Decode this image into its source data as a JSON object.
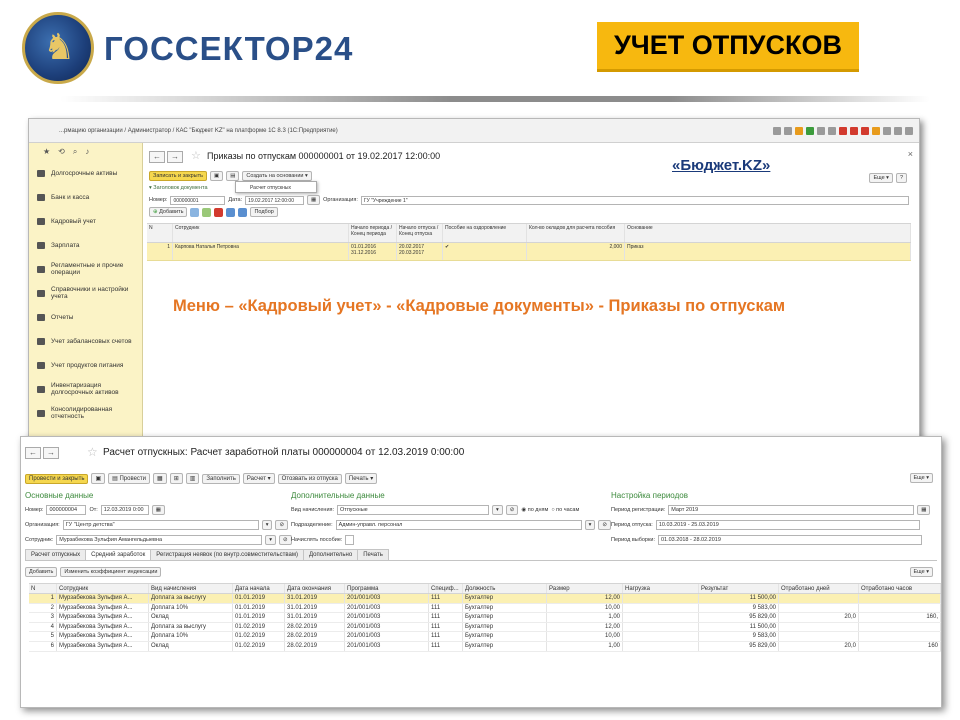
{
  "slide": {
    "logo_text": "ГОССЕКТОР24",
    "title_badge": "УЧЕТ ОТПУСКОВ",
    "caption": "Меню – «Кадровый учет» - «Кадровые документы» - Приказы по отпускам",
    "budget_link": "«Бюджет.KZ»",
    "colors": {
      "badge": "#f7b80f",
      "caption": "#e57623",
      "brand_blue": "#2a4f88"
    }
  },
  "window1": {
    "titlebar": "...рмацию организации / Администратор / КАС \"Бюджет KZ\" на платформе 1С 8.3 (1С:Предприятие)",
    "sidebar": {
      "items": [
        "Долгосрочные активы",
        "Банк и касса",
        "Кадровый учет",
        "Зарплата",
        "Регламентные и прочие операции",
        "Справочники и настройки учета",
        "Отчеты",
        "Учет забалансовых счетов",
        "Учет продуктов питания",
        "Инвентаризация долгосрочных активов",
        "Консолидированная отчетность"
      ]
    },
    "doc_title": "Приказы по отпускам 000000001 от 19.02.2017 12:00:00",
    "toolbar": {
      "save_close": "Записать и закрыть",
      "create_based": "Создать на основании",
      "dropdown_item": "Расчет отпускных",
      "more": "Еще",
      "help": "?"
    },
    "header_link": "Заголовок документа",
    "form": {
      "number_label": "Номер:",
      "number_value": "000000001",
      "date_label": "Дата:",
      "date_value": "19.02.2017 12:00:00",
      "org_label": "Организация:",
      "org_value": "ГУ \"Учреждение 1\""
    },
    "table_toolbar": {
      "add": "Добавить",
      "pick": "Подбор",
      "more": "Еще"
    },
    "table": {
      "headers": [
        "N",
        "Сотрудник",
        "Начало периода / Конец периода",
        "Начало отпуска / Конец отпуска",
        "Пособие на оздоровление",
        "Кол-во окладов для расчета пособия",
        "Основание"
      ],
      "rows": [
        {
          "n": "1",
          "employee": "Карпова Наталья Петровна",
          "period_start": "01.01.2016",
          "period_end": "31.12.2016",
          "vac_start": "20.02.2017",
          "vac_end": "20.03.2017",
          "benefit": "✔",
          "salaries": "2,000",
          "basis": "Приказ"
        }
      ]
    }
  },
  "window2": {
    "title": "Расчет отпускных: Расчет заработной платы 000000004 от 12.03.2019 0:00:00",
    "toolbar": {
      "post_close": "Провести и закрыть",
      "post": "Провести",
      "fill": "Заполнить",
      "calc": "Расчет",
      "recall": "Отозвать из отпуска",
      "print": "Печать",
      "more": "Еще"
    },
    "sections": {
      "main": "Основные данные",
      "extra": "Дополнительные данные",
      "periods": "Настройка периодов"
    },
    "form": {
      "number_label": "Номер:",
      "number_value": "000000004",
      "from_label": "От:",
      "from_value": "12.03.2019 0:00",
      "org_label": "Организация:",
      "org_value": "ГУ \"Центр детства\"",
      "employee_label": "Сотрудник:",
      "employee_value": "Мурзабекова Зульфия Амангельдыевна",
      "accrual_label": "Вид начисления:",
      "accrual_value": "Отпускные",
      "by_days": "по дням",
      "by_hours": "по часам",
      "dept_label": "Подразделение:",
      "dept_value": "Админ-управл. персонал",
      "benefit_label": "Начислять пособие:",
      "reg_period_label": "Период регистрации:",
      "reg_period_value": "Март 2019",
      "vac_period_label": "Период отпуска:",
      "vac_period_value": "10.03.2019 - 25.03.2019",
      "sample_period_label": "Период выборки:",
      "sample_period_value": "01.03.2018 - 28.02.2019"
    },
    "tabs": [
      "Расчет отпускных",
      "Средний заработок",
      "Регистрация неявок (по внутр.совместительствам)",
      "Дополнительно",
      "Печать"
    ],
    "sub_toolbar": {
      "add": "Добавить",
      "change_coef": "Изменить коэффициент индексации",
      "more": "Еще"
    },
    "table": {
      "headers": [
        "N",
        "Сотрудник",
        "Вид начисления",
        "Дата начала",
        "Дата окончания",
        "Программа",
        "Специф...",
        "Должность",
        "Размер",
        "Нагрузка",
        "Результат",
        "Отработано дней",
        "Отработано часов"
      ],
      "rows": [
        {
          "n": "1",
          "emp": "Мурзабекова Зульфия А...",
          "kind": "Доплата за выслугу",
          "start": "01.01.2019",
          "end": "31.01.2019",
          "prog": "201/001/003",
          "spec": "111",
          "pos": "Бухгалтер",
          "size": "12,00",
          "load": "",
          "result": "11 500,00",
          "days": "",
          "hours": ""
        },
        {
          "n": "2",
          "emp": "Мурзабекова Зульфия А...",
          "kind": "Доплата 10%",
          "start": "01.01.2019",
          "end": "31.01.2019",
          "prog": "201/001/003",
          "spec": "111",
          "pos": "Бухгалтер",
          "size": "10,00",
          "load": "",
          "result": "9 583,00",
          "days": "",
          "hours": ""
        },
        {
          "n": "3",
          "emp": "Мурзабекова Зульфия А...",
          "kind": "Оклад",
          "start": "01.01.2019",
          "end": "31.01.2019",
          "prog": "201/001/003",
          "spec": "111",
          "pos": "Бухгалтер",
          "size": "1,00",
          "load": "",
          "result": "95 829,00",
          "days": "20,0",
          "hours": "160,"
        },
        {
          "n": "4",
          "emp": "Мурзабекова Зульфия А...",
          "kind": "Доплата за выслугу",
          "start": "01.02.2019",
          "end": "28.02.2019",
          "prog": "201/001/003",
          "spec": "111",
          "pos": "Бухгалтер",
          "size": "12,00",
          "load": "",
          "result": "11 500,00",
          "days": "",
          "hours": ""
        },
        {
          "n": "5",
          "emp": "Мурзабекова Зульфия А...",
          "kind": "Доплата 10%",
          "start": "01.02.2019",
          "end": "28.02.2019",
          "prog": "201/001/003",
          "spec": "111",
          "pos": "Бухгалтер",
          "size": "10,00",
          "load": "",
          "result": "9 583,00",
          "days": "",
          "hours": ""
        },
        {
          "n": "6",
          "emp": "Мурзабекова Зульфия А...",
          "kind": "Оклад",
          "start": "01.02.2019",
          "end": "28.02.2019",
          "prog": "201/001/003",
          "spec": "111",
          "pos": "Бухгалтер",
          "size": "1,00",
          "load": "",
          "result": "95 829,00",
          "days": "20,0",
          "hours": "160"
        }
      ]
    }
  }
}
